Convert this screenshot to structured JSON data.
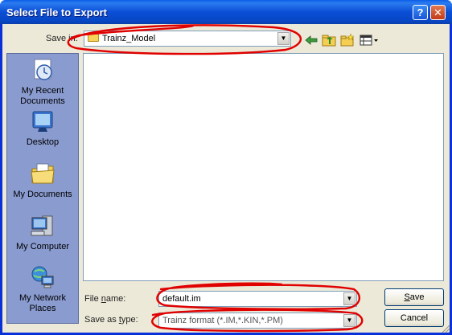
{
  "window": {
    "title": "Select File to Export",
    "help_glyph": "?",
    "close_glyph": "✕"
  },
  "save_in": {
    "label": "Save in:",
    "value": "Trainz_Model"
  },
  "toolbar": {
    "icons": [
      "back-arrow-icon",
      "up-folder-icon",
      "new-folder-icon",
      "view-menu-icon"
    ]
  },
  "places": {
    "items": [
      {
        "label": "My Recent Documents",
        "icon": "recent-documents-icon"
      },
      {
        "label": "Desktop",
        "icon": "desktop-icon"
      },
      {
        "label": "My Documents",
        "icon": "my-documents-icon"
      },
      {
        "label": "My Computer",
        "icon": "my-computer-icon"
      },
      {
        "label": "My Network Places",
        "icon": "network-places-icon"
      }
    ]
  },
  "file_name": {
    "label_pre": "File ",
    "label_u": "n",
    "label_post": "ame:",
    "value": "default.im"
  },
  "save_type": {
    "label_pre": "Save as ",
    "label_u": "t",
    "label_post": "ype:",
    "value": "Trainz format (*.IM,*.KIN,*.PM)"
  },
  "buttons": {
    "save_u": "S",
    "save_rest": "ave",
    "cancel": "Cancel"
  },
  "colors": {
    "title_bar": "#0b4ed6",
    "annotation": "#e00000",
    "places_bar": "#8a9bd0"
  }
}
